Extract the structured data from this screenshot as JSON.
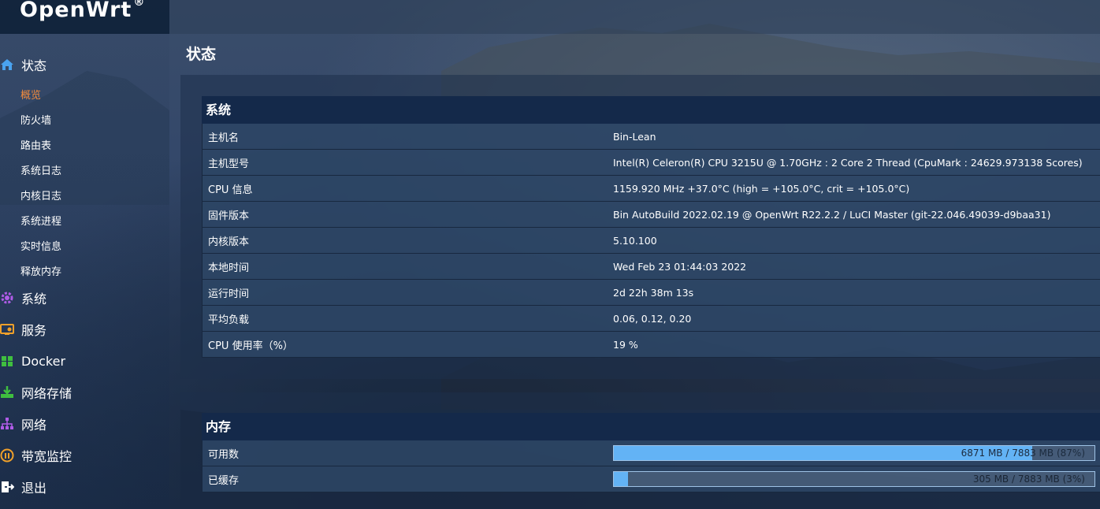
{
  "brand": {
    "name": "OpenWrt",
    "mark": "®"
  },
  "page": {
    "title": "状态"
  },
  "sidebar": {
    "status": {
      "label": "状态",
      "icon": "home-icon",
      "items": [
        "概览",
        "防火墙",
        "路由表",
        "系统日志",
        "内核日志",
        "系统进程",
        "实时信息",
        "释放内存"
      ],
      "active_index": 0
    },
    "groups": [
      {
        "label": "系统",
        "icon": "gear-icon",
        "color": "#b05ce8"
      },
      {
        "label": "服务",
        "icon": "services-icon",
        "color": "#f0a02a"
      },
      {
        "label": "Docker",
        "icon": "docker-icon",
        "color": "#3fbf3f"
      },
      {
        "label": "网络存储",
        "icon": "storage-icon",
        "color": "#3fbf3f"
      },
      {
        "label": "网络",
        "icon": "network-icon",
        "color": "#b05ce8"
      },
      {
        "label": "带宽监控",
        "icon": "bandwidth-icon",
        "color": "#f0a02a"
      },
      {
        "label": "退出",
        "icon": "logout-icon",
        "color": "#ffffff"
      }
    ]
  },
  "system": {
    "heading": "系统",
    "rows": [
      {
        "key": "主机名",
        "value": "Bin-Lean"
      },
      {
        "key": "主机型号",
        "value": "Intel(R) Celeron(R) CPU 3215U @ 1.70GHz : 2 Core 2 Thread (CpuMark : 24629.973138 Scores)"
      },
      {
        "key": "CPU 信息",
        "value": "1159.920 MHz +37.0°C (high = +105.0°C, crit = +105.0°C)"
      },
      {
        "key": "固件版本",
        "value": "Bin AutoBuild 2022.02.19 @ OpenWrt R22.2.2 / LuCI Master (git-22.046.49039-d9baa31)"
      },
      {
        "key": "内核版本",
        "value": "5.10.100"
      },
      {
        "key": "本地时间",
        "value": "Wed Feb 23 01:44:03 2022"
      },
      {
        "key": "运行时间",
        "value": "2d 22h 38m 13s"
      },
      {
        "key": "平均负载",
        "value": "0.06, 0.12, 0.20"
      },
      {
        "key": "CPU 使用率（%）",
        "value": "19 %"
      }
    ]
  },
  "memory": {
    "heading": "内存",
    "rows": [
      {
        "key": "可用数",
        "text": "6871 MB / 7883 MB (87%)",
        "percent": 87
      },
      {
        "key": "已缓存",
        "text": "305 MB / 7883 MB (3%)",
        "percent": 3
      }
    ]
  },
  "colors": {
    "accent_active": "#f38b3c",
    "bar_fill": "#63b3f5",
    "section_head": "#14294a"
  }
}
